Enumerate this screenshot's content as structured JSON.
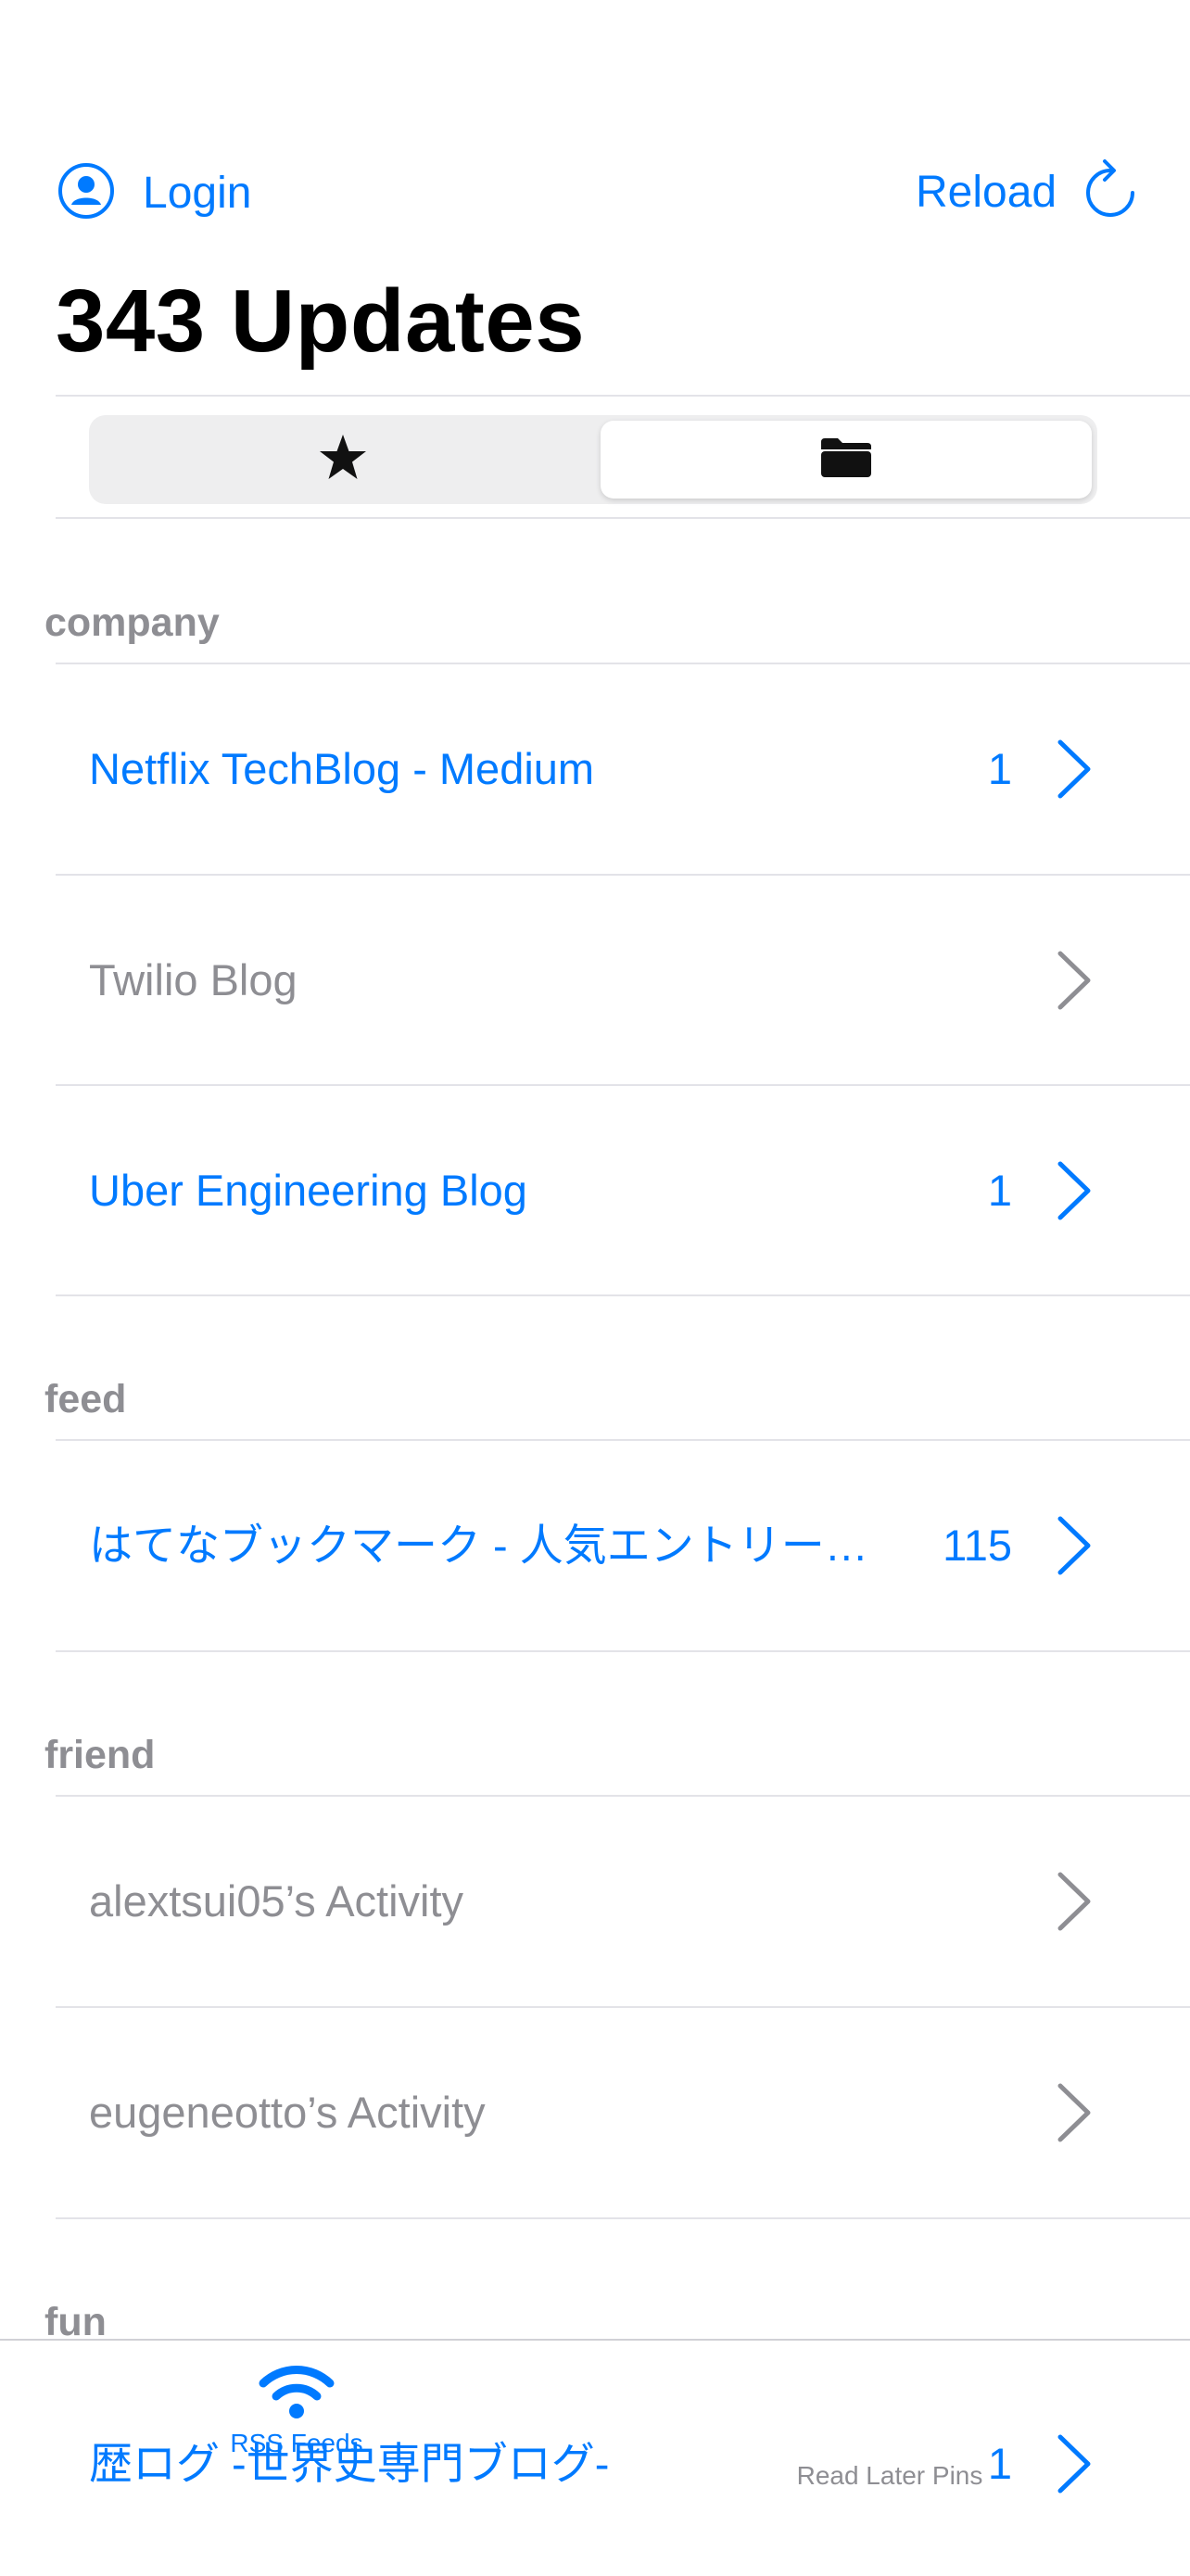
{
  "nav": {
    "login_label": "Login",
    "reload_label": "Reload"
  },
  "header": {
    "title": "343 Updates"
  },
  "segmented": {
    "left_icon": "star-icon",
    "right_icon": "folder-icon",
    "selected": "folder"
  },
  "sections": [
    {
      "name": "company",
      "rows": [
        {
          "title": "Netflix TechBlog - Medium",
          "count": "1",
          "unread": true
        },
        {
          "title": "Twilio Blog",
          "count": "",
          "unread": false
        },
        {
          "title": "Uber Engineering Blog",
          "count": "1",
          "unread": true
        }
      ]
    },
    {
      "name": "feed",
      "rows": [
        {
          "title": "はてなブックマーク - 人気エントリー…",
          "count": "115",
          "unread": true
        }
      ]
    },
    {
      "name": "friend",
      "rows": [
        {
          "title": "alextsui05’s Activity",
          "count": "",
          "unread": false
        },
        {
          "title": "eugeneotto’s Activity",
          "count": "",
          "unread": false
        }
      ]
    },
    {
      "name": "fun",
      "rows": [
        {
          "title": "歴ログ -世界史専門ブログ-",
          "count": "1",
          "unread": true
        }
      ]
    }
  ],
  "tabbar": {
    "tabs": [
      {
        "label": "RSS Feeds",
        "icon": "wifi-icon",
        "active": true
      },
      {
        "label": "Read Later Pins",
        "icon": "pin-icon",
        "active": false
      }
    ]
  },
  "colors": {
    "accent": "#007aff",
    "secondary": "#8e8e93",
    "separator": "#e3e3e8"
  }
}
